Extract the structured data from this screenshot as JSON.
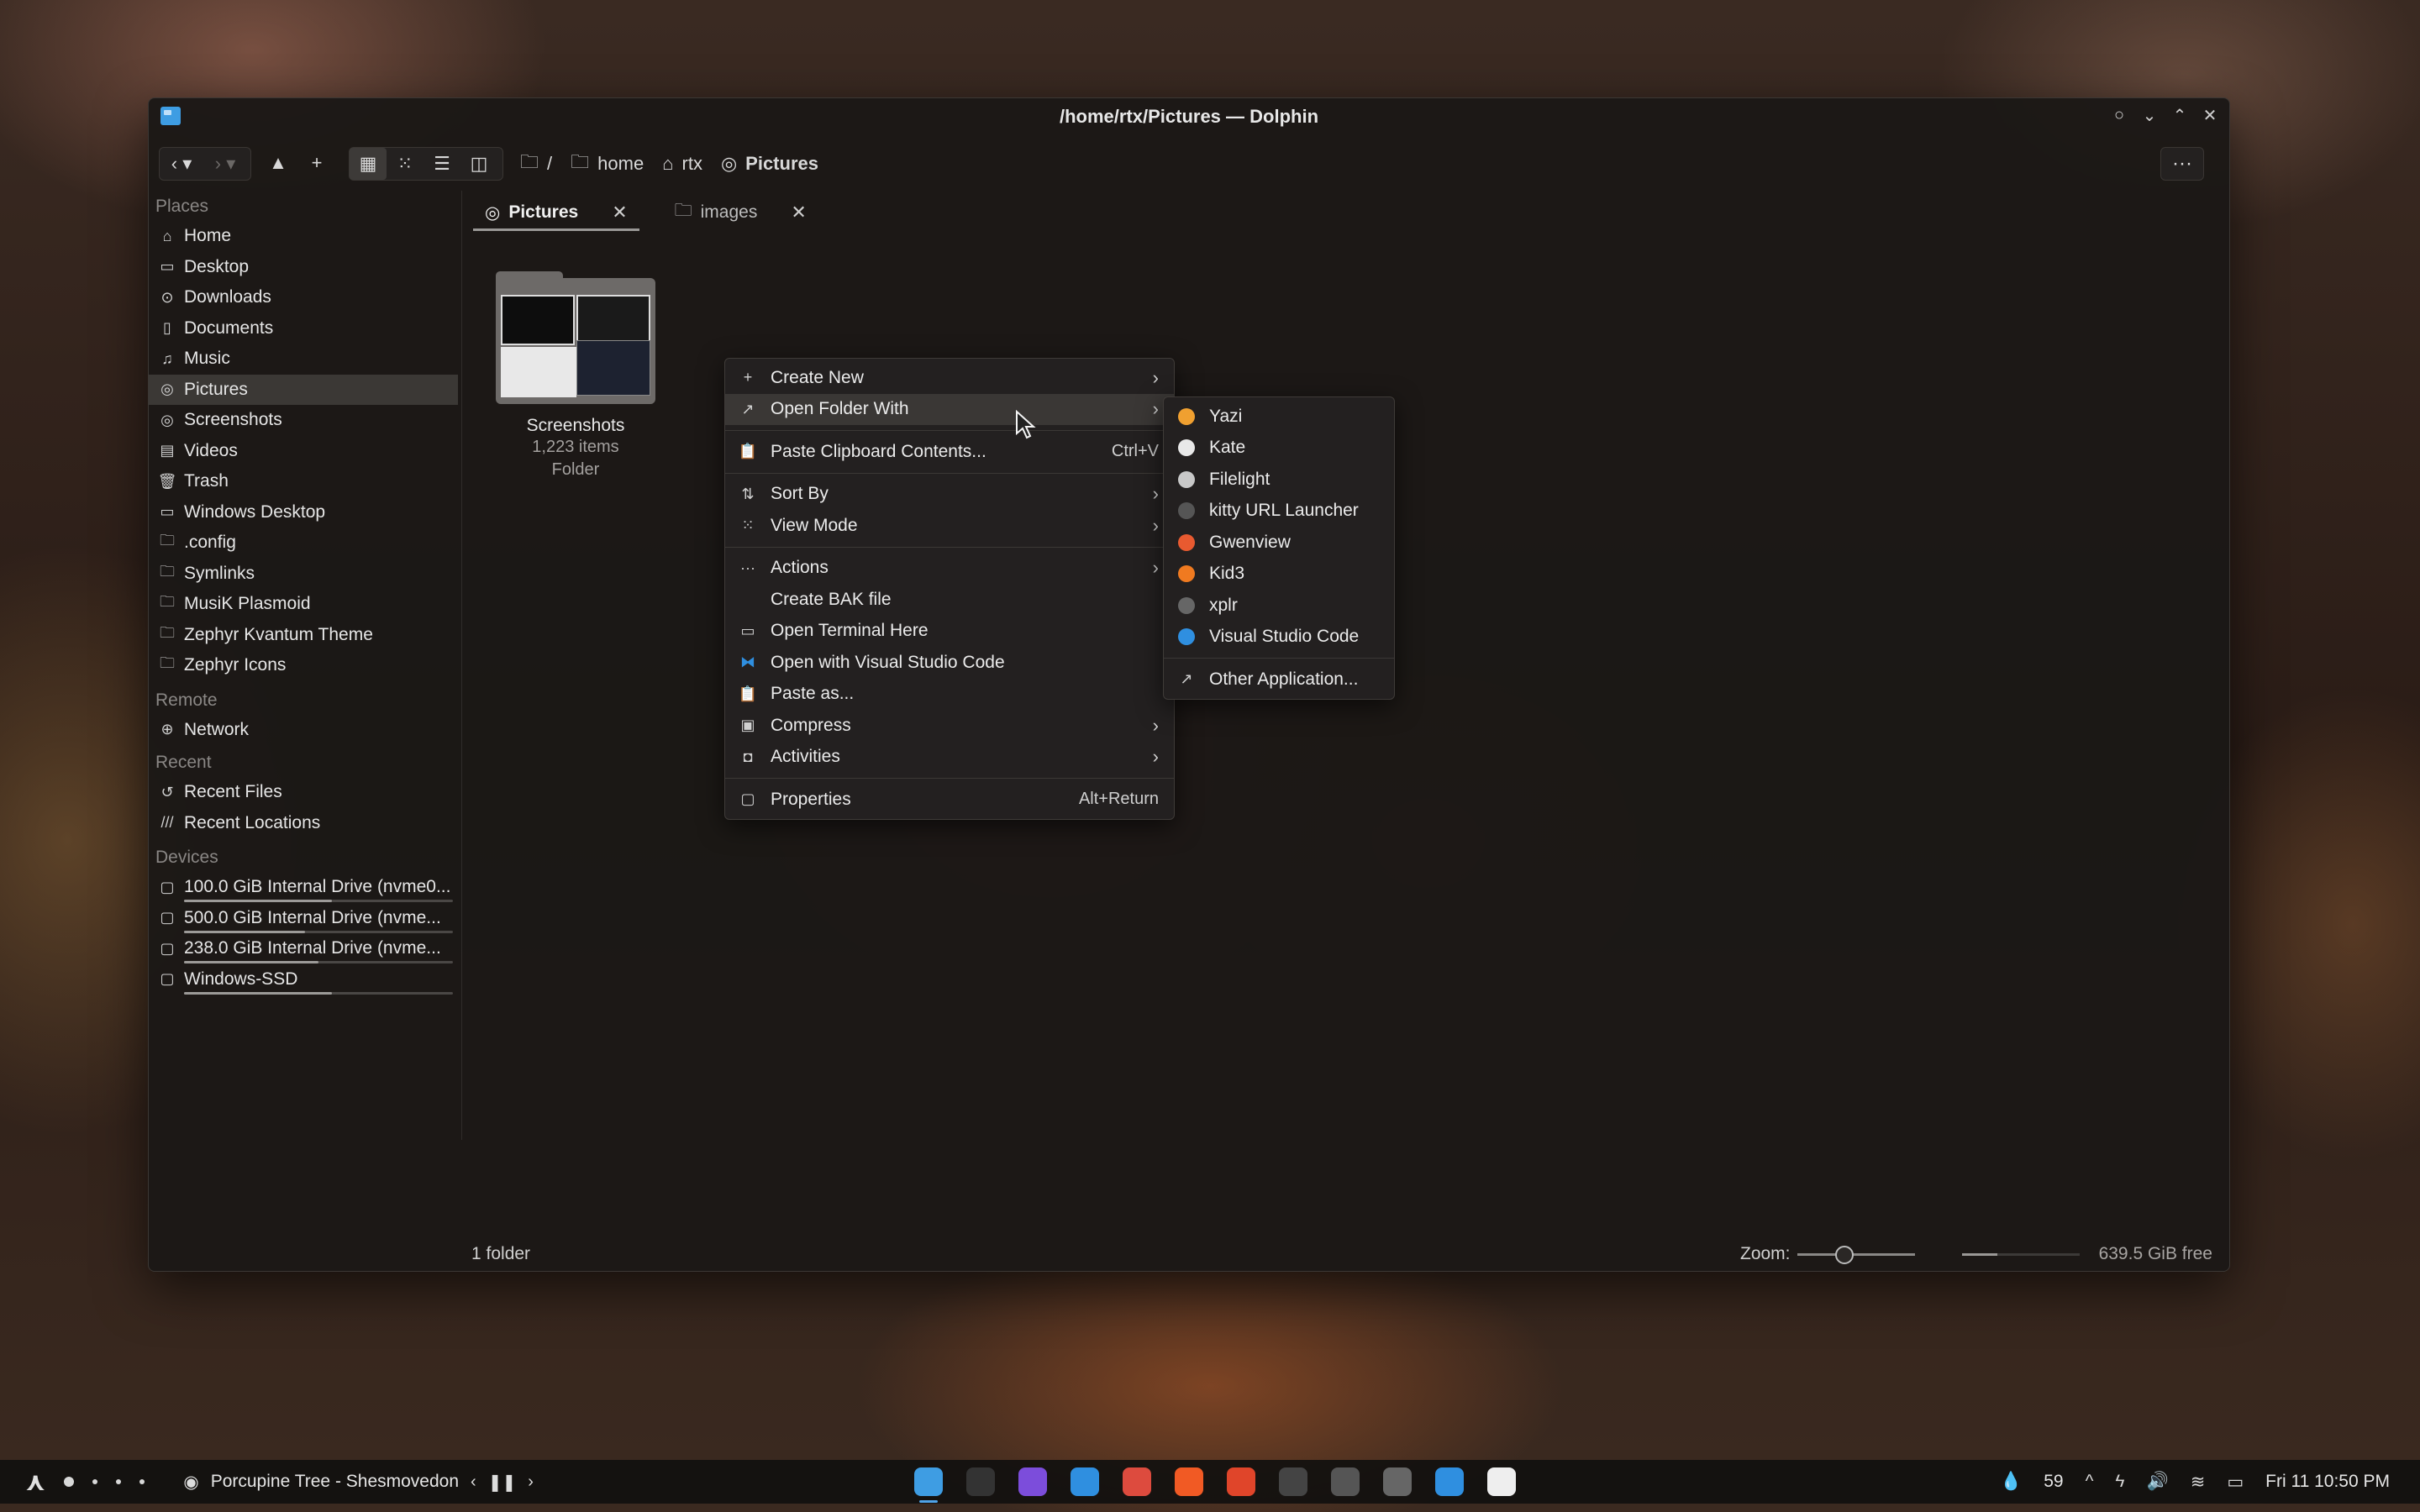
{
  "window": {
    "title": "/home/rtx/Pictures — Dolphin"
  },
  "toolbar": {
    "breadcrumb": [
      {
        "label": "/",
        "icon": "folder-icon"
      },
      {
        "label": "home",
        "icon": "folder-icon"
      },
      {
        "label": "rtx",
        "icon": "home-icon"
      },
      {
        "label": "Pictures",
        "icon": "camera-icon"
      }
    ],
    "more_label": "···"
  },
  "sidebar": {
    "places_title": "Places",
    "places": [
      {
        "label": "Home",
        "icon": "home-icon"
      },
      {
        "label": "Desktop",
        "icon": "desktop-icon"
      },
      {
        "label": "Downloads",
        "icon": "download-icon"
      },
      {
        "label": "Documents",
        "icon": "document-icon"
      },
      {
        "label": "Music",
        "icon": "music-icon"
      },
      {
        "label": "Pictures",
        "icon": "camera-icon",
        "selected": true
      },
      {
        "label": "Screenshots",
        "icon": "camera-icon"
      },
      {
        "label": "Videos",
        "icon": "film-icon"
      },
      {
        "label": "Trash",
        "icon": "trash-icon"
      },
      {
        "label": "Windows Desktop",
        "icon": "desktop-icon"
      },
      {
        "label": ".config",
        "icon": "folder-icon"
      },
      {
        "label": "Symlinks",
        "icon": "folder-icon"
      },
      {
        "label": "MusiK Plasmoid",
        "icon": "folder-icon"
      },
      {
        "label": "Zephyr Kvantum Theme",
        "icon": "folder-icon"
      },
      {
        "label": "Zephyr Icons",
        "icon": "folder-icon"
      }
    ],
    "remote_title": "Remote",
    "remote": [
      {
        "label": "Network",
        "icon": "globe-icon"
      }
    ],
    "recent_title": "Recent",
    "recent": [
      {
        "label": "Recent Files",
        "icon": "history-icon"
      },
      {
        "label": "Recent Locations",
        "icon": "slashes-icon"
      }
    ],
    "devices_title": "Devices",
    "devices": [
      {
        "label": "100.0 GiB Internal Drive (nvme0...",
        "usage": 0.55
      },
      {
        "label": "500.0 GiB Internal Drive (nvme...",
        "usage": 0.45
      },
      {
        "label": "238.0 GiB Internal Drive (nvme...",
        "usage": 0.5
      },
      {
        "label": "Windows-SSD",
        "usage": 0.55
      }
    ]
  },
  "tabs": [
    {
      "label": "Pictures",
      "icon": "camera-icon",
      "active": true,
      "close": "✕"
    },
    {
      "label": "images",
      "icon": "folder-icon",
      "active": false,
      "close": "✕"
    }
  ],
  "files": [
    {
      "name": "Screenshots",
      "count": "1,223 items",
      "type": "Folder"
    }
  ],
  "status": {
    "summary": "1 folder",
    "zoom_label": "Zoom:",
    "zoom_level": 0.4,
    "free_space": "639.5 GiB free",
    "free_fill": 0.3
  },
  "context_menu": {
    "items": [
      {
        "label": "Create New",
        "icon": "plus-icon",
        "submenu": true
      },
      {
        "label": "Open Folder With",
        "icon": "arrow-up-right-icon",
        "submenu": true,
        "hover": true
      },
      {
        "sep": true
      },
      {
        "label": "Paste Clipboard Contents...",
        "icon": "clipboard-icon",
        "shortcut": "Ctrl+V"
      },
      {
        "sep": true
      },
      {
        "label": "Sort By",
        "icon": "sort-icon",
        "submenu": true
      },
      {
        "label": "View Mode",
        "icon": "grid-icon",
        "submenu": true
      },
      {
        "sep": true
      },
      {
        "label": "Actions",
        "icon": "ellipsis-icon",
        "submenu": true
      },
      {
        "label": "Create BAK file",
        "icon": ""
      },
      {
        "label": "Open Terminal Here",
        "icon": "terminal-icon"
      },
      {
        "label": "Open with Visual Studio Code",
        "icon": "vscode-icon"
      },
      {
        "label": "Paste as...",
        "icon": "clipboard-icon"
      },
      {
        "label": "Compress",
        "icon": "archive-icon",
        "submenu": true
      },
      {
        "label": "Activities",
        "icon": "activities-icon",
        "submenu": true
      },
      {
        "sep": true
      },
      {
        "label": "Properties",
        "icon": "properties-icon",
        "shortcut": "Alt+Return"
      }
    ]
  },
  "open_with_menu": {
    "items": [
      {
        "label": "Yazi",
        "icon": "yazi-icon",
        "color": "#f0a030"
      },
      {
        "label": "Kate",
        "icon": "kate-icon",
        "color": "#e8e8e8"
      },
      {
        "label": "Filelight",
        "icon": "filelight-icon",
        "color": "#c8c8c8"
      },
      {
        "label": "kitty URL Launcher",
        "icon": "kitty-icon",
        "color": "#555555"
      },
      {
        "label": "Gwenview",
        "icon": "gwenview-icon",
        "color": "#e85a30"
      },
      {
        "label": "Kid3",
        "icon": "kid3-icon",
        "color": "#f07a20"
      },
      {
        "label": "xplr",
        "icon": "xplr-icon",
        "color": "#666666"
      },
      {
        "label": "Visual Studio Code",
        "icon": "vscode-icon",
        "color": "#2f8fe0"
      },
      {
        "sep": true
      },
      {
        "label": "Other Application...",
        "icon": "arrow-up-right-icon"
      }
    ]
  },
  "taskbar": {
    "media_title": "Porcupine Tree - Shesmovedon",
    "tray_value": "59",
    "clock": "Fri 11  10:50 PM",
    "apps": [
      {
        "name": "dolphin",
        "color": "#3e9de3",
        "active": true
      },
      {
        "name": "terminal",
        "color": "#333333"
      },
      {
        "name": "obsidian",
        "color": "#7c4ddb"
      },
      {
        "name": "vscode",
        "color": "#2f8fe0"
      },
      {
        "name": "chrome",
        "color": "#dd4b3e"
      },
      {
        "name": "brave",
        "color": "#f15a24"
      },
      {
        "name": "brave-alt",
        "color": "#e0452a"
      },
      {
        "name": "obs",
        "color": "#444444"
      },
      {
        "name": "settings",
        "color": "#555555"
      },
      {
        "name": "spotify-tray",
        "color": "#666666"
      },
      {
        "name": "downloads-10k",
        "color": "#2f8fe0"
      },
      {
        "name": "blocker",
        "color": "#eeeeee"
      }
    ]
  }
}
